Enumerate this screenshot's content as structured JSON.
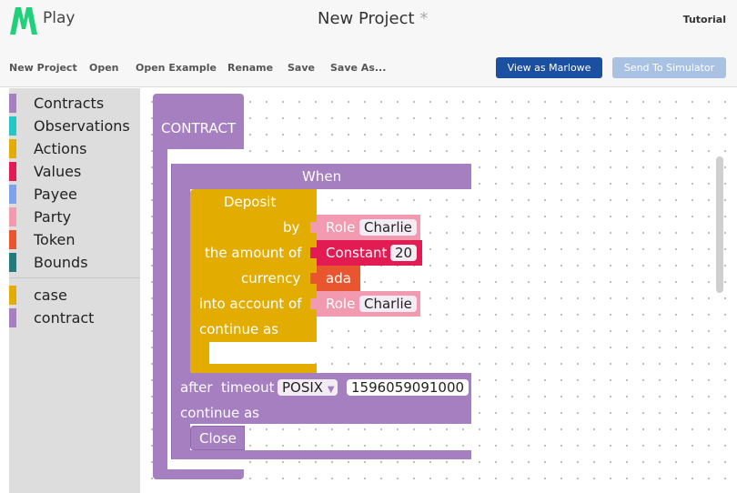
{
  "header": {
    "logo_text": "Play",
    "project_title": "New Project",
    "unsaved_marker": "*",
    "tutorial_label": "Tutorial"
  },
  "toolbar": {
    "new_project": "New Project",
    "open": "Open",
    "open_example": "Open Example",
    "rename": "Rename",
    "save": "Save",
    "save_as": "Save As...",
    "view_as_marlowe": "View as Marlowe",
    "send_to_simulator": "Send To Simulator"
  },
  "toolbox": {
    "categories": [
      {
        "label": "Contracts",
        "color": "#a57fbf"
      },
      {
        "label": "Observations",
        "color": "#26c6c6"
      },
      {
        "label": "Actions",
        "color": "#e3ac00"
      },
      {
        "label": "Values",
        "color": "#e31b53"
      },
      {
        "label": "Payee",
        "color": "#7fa2ea"
      },
      {
        "label": "Party",
        "color": "#f29aaf"
      },
      {
        "label": "Token",
        "color": "#e8552e"
      },
      {
        "label": "Bounds",
        "color": "#227a7a"
      }
    ],
    "extras": [
      {
        "label": "case",
        "color": "#e3ac00"
      },
      {
        "label": "contract",
        "color": "#a57fbf"
      }
    ]
  },
  "blocks": {
    "contract_label": "CONTRACT",
    "when_label": "When",
    "deposit": {
      "title": "Deposit",
      "by_label": "by",
      "amount_label": "the amount of",
      "currency_label": "currency",
      "account_label": "into account of",
      "continue_label": "continue as"
    },
    "by_party": {
      "kind": "Role",
      "name": "Charlie"
    },
    "amount": {
      "kind": "Constant",
      "value": "20"
    },
    "currency_token": "ada",
    "account_party": {
      "kind": "Role",
      "name": "Charlie"
    },
    "timeout": {
      "after_label": "after",
      "timeout_label": "timeout",
      "type": "POSIX",
      "value": "1596059091000",
      "continue_label": "continue as"
    },
    "close_label": "Close"
  }
}
